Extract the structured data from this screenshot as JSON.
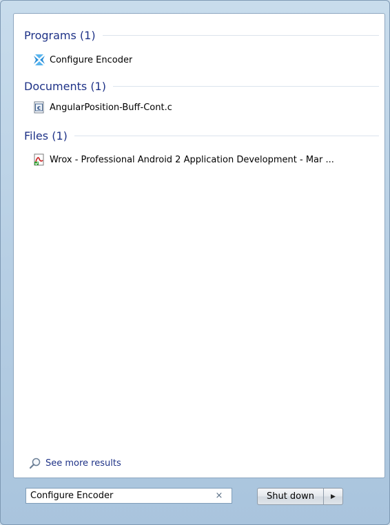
{
  "groups": [
    {
      "title": "Programs (1)",
      "items": [
        {
          "label": "Configure Encoder",
          "icon": "configure-encoder-icon"
        }
      ]
    },
    {
      "title": "Documents (1)",
      "items": [
        {
          "label": "AngularPosition-Buff-Cont.c",
          "icon": "c-file-icon"
        }
      ]
    },
    {
      "title": "Files (1)",
      "items": [
        {
          "label": "Wrox - Professional Android 2 Application Development - Mar ...",
          "icon": "pdf-file-icon"
        }
      ]
    }
  ],
  "see_more": {
    "label": "See more results",
    "icon": "search-icon"
  },
  "search": {
    "value": "Configure Encoder",
    "clear": "×"
  },
  "shutdown": {
    "label": "Shut down",
    "arrow": "▶"
  },
  "colors": {
    "accent": "#1e3287",
    "frame": "#b7cfe4"
  }
}
